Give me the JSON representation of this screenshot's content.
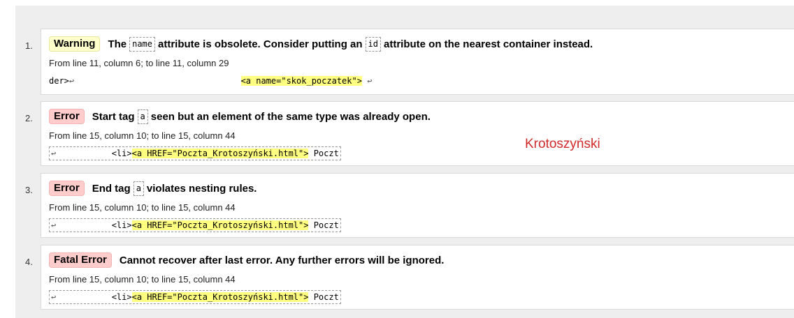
{
  "messages": [
    {
      "num": "1.",
      "type": "Warning",
      "parts": [
        "The",
        "name",
        "attribute is obsolete. Consider putting an",
        "id",
        "attribute on the nearest container instead."
      ],
      "location": "From line 11, column 6; to line 11, column 29",
      "extract_pre": "der>",
      "extract_hl": "<a name=\"skok_poczatek\">",
      "extract_post": ""
    },
    {
      "num": "2.",
      "type": "Error",
      "parts": [
        "Start tag",
        "a",
        "seen but an element of the same type was already open."
      ],
      "location": "From line 15, column 10; to line 15, column 44",
      "extract_pre": "           <li>",
      "extract_hl": "<a HREF=\"Poczta_Krotoszyński.html\">",
      "extract_post": " Poczt"
    },
    {
      "num": "3.",
      "type": "Error",
      "parts": [
        "End tag",
        "a",
        "violates nesting rules."
      ],
      "location": "From line 15, column 10; to line 15, column 44",
      "extract_pre": "           <li>",
      "extract_hl": "<a HREF=\"Poczta_Krotoszyński.html\">",
      "extract_post": " Poczt"
    },
    {
      "num": "4.",
      "type": "Fatal Error",
      "parts": [
        "Cannot recover after last error. Any further errors will be ignored."
      ],
      "location": "From line 15, column 10; to line 15, column 44",
      "extract_pre": "           <li>",
      "extract_hl": "<a HREF=\"Poczta_Krotoszyński.html\">",
      "extract_post": " Poczt"
    }
  ],
  "return_glyph": "↩",
  "annotation": "Krotoszyński",
  "colors": {
    "warning_bg": "#ffffcc",
    "error_bg": "#ffcccc",
    "highlight": "#ffff80",
    "annotation": "#d12a2a"
  }
}
